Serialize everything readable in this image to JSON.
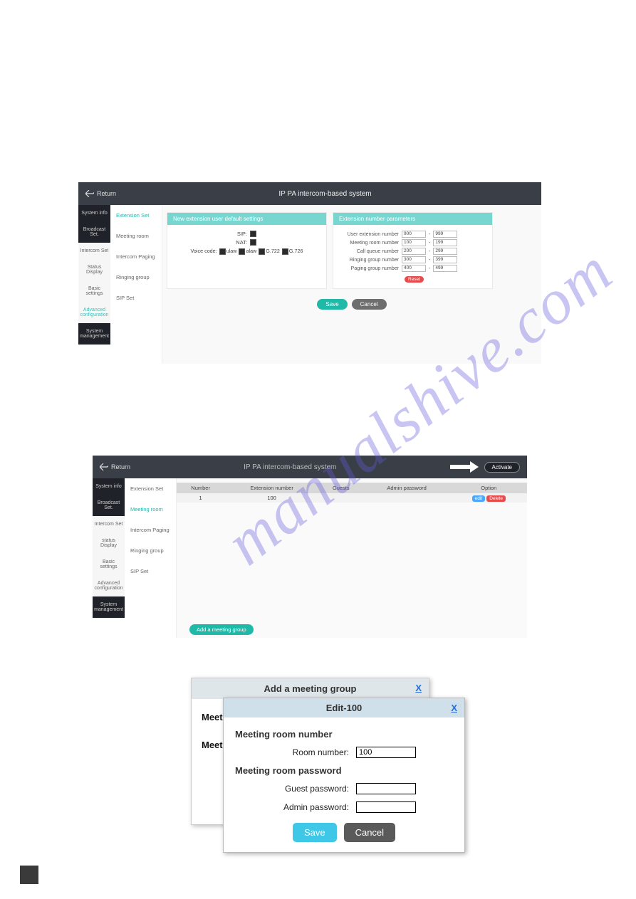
{
  "app_title": "IP PA intercom-based system",
  "return_label": "Return",
  "panel1": {
    "leftnav": [
      "System info",
      "Broadcast Set.",
      "Intercom Set",
      "Status Display",
      "Basic settings",
      "Advanced configuration",
      "System management"
    ],
    "leftnav_active_index": 5,
    "leftnav_dark_indices": [
      0,
      1,
      6
    ],
    "subnav": [
      "Extension Set",
      "Meeting room",
      "Intercom Paging",
      "Ringing group",
      "SIP Set"
    ],
    "subnav_active_index": 0,
    "card1_title": "New extension user default settings",
    "card1_rows": {
      "sip_label": "SIP:",
      "nat_label": "NAT:",
      "voice_label": "Voice code:",
      "voice_opts": [
        "ulaw",
        "alaw",
        "G.722",
        "G.726"
      ]
    },
    "card2_title": "Extension number parameters",
    "card2_rows": [
      {
        "label": "User extension number",
        "from": "900",
        "to": "999"
      },
      {
        "label": "Meeting room number",
        "from": "100",
        "to": "199"
      },
      {
        "label": "Call queue number",
        "from": "200",
        "to": "299"
      },
      {
        "label": "Ringing group number",
        "from": "300",
        "to": "399"
      },
      {
        "label": "Paging group number",
        "from": "400",
        "to": "499"
      }
    ],
    "reset_label": "Reset",
    "save_label": "Save",
    "cancel_label": "Cancel"
  },
  "panel2": {
    "activate_label": "Activate",
    "leftnav": [
      "System info",
      "Broadcast Set.",
      "Intercom Set",
      "status Display",
      "Basic settings",
      "Advanced configuration",
      "System management"
    ],
    "leftnav_dark_indices": [
      0,
      1,
      6
    ],
    "subnav": [
      "Extension Set",
      "Meeting room",
      "Intercom Paging",
      "Ringing group",
      "SIP Set"
    ],
    "subnav_active_index": 1,
    "columns": [
      "Number",
      "Extension number",
      "Guests",
      "Admin password",
      "Option"
    ],
    "rows": [
      {
        "number": "1",
        "extension": "100",
        "guests": "",
        "admin": "",
        "edit": "edit",
        "delete": "Delete"
      }
    ],
    "add_label": "Add a meeting group"
  },
  "panel3": {
    "back_title": "Add a meeting group",
    "back_close": "X",
    "back_label1": "Meetir",
    "back_label2": "Meeti",
    "front_title": "Edit-100",
    "front_close": "X",
    "sect1": "Meeting room number",
    "room_label": "Room number:",
    "room_value": "100",
    "sect2": "Meeting room password",
    "guest_label": "Guest password:",
    "admin_label": "Admin password:",
    "save_label": "Save",
    "cancel_label": "Cancel"
  }
}
